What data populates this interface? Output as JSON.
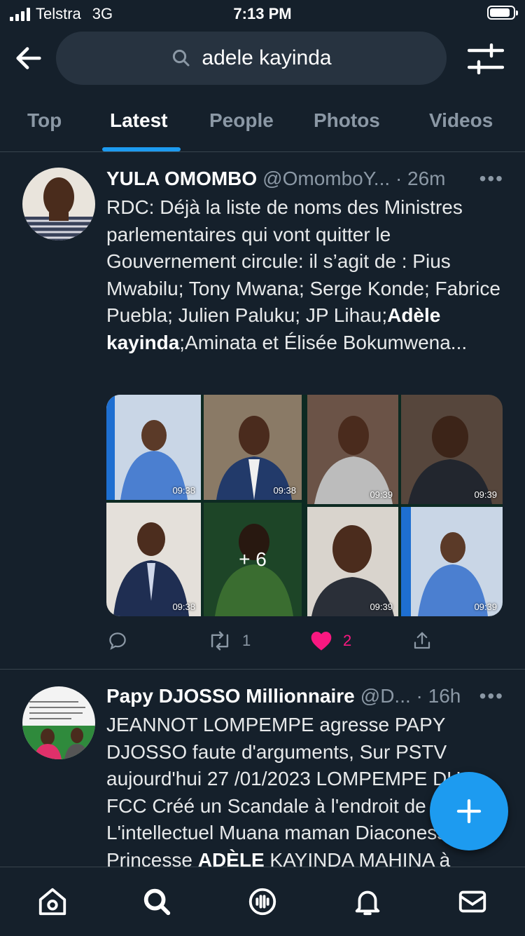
{
  "status_bar": {
    "carrier": "Telstra",
    "network": "3G",
    "time": "7:13 PM"
  },
  "search": {
    "query": "adele kayinda"
  },
  "tabs": [
    {
      "label": "Top"
    },
    {
      "label": "Latest"
    },
    {
      "label": "People"
    },
    {
      "label": "Photos"
    },
    {
      "label": "Videos"
    }
  ],
  "active_tab": "Latest",
  "tweets": [
    {
      "name": "YULA OMOMBO",
      "handle": "@OmomboY...",
      "time": "· 26m",
      "more": "•••",
      "text_before": "RDC: Déjà la liste de noms des Ministres parlementaires qui vont quitter le Gouvernement circule: il s’agit de : Pius Mwabilu; Tony Mwana; Serge Konde; Fabrice Puebla; Julien Paluku; JP Lihau;",
      "text_bold": "Adèle kayinda",
      "text_after": ";Aminata et Élisée Bokumwena...",
      "media_timestamps": [
        "09:38",
        "09:38",
        "09:38",
        "09:39",
        "09:39",
        "09:39",
        "09:39"
      ],
      "media_more": "+ 6",
      "retweets": "1",
      "likes": "2"
    },
    {
      "name": "Papy DJOSSO Millionnaire",
      "handle": "@D...",
      "time": "· 16h",
      "more": "•••",
      "text_before": "JEANNOT LOMPEMPE agresse PAPY DJOSSO faute d'arguments, Sur PSTV aujourd'hui 27 /01/2023 LOMPEMPE DU FCC Créé un Scandale à l'endroit de L'intellectuel Muana maman Diaconesse Princesse",
      "text_bold": "ADÈLE",
      "text_after": " KAYINDA MAHINA à"
    }
  ],
  "colors": {
    "accent": "#1d9bf0",
    "like": "#f91880",
    "background": "#15202b"
  },
  "bottom_nav": [
    "home-icon",
    "search-icon",
    "spaces-icon",
    "notifications-icon",
    "messages-icon"
  ]
}
